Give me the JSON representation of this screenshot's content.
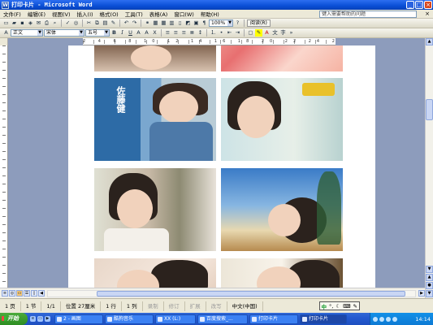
{
  "window": {
    "title": "打印卡片 - Microsoft Word",
    "icon_letter": "W"
  },
  "menu": {
    "items": [
      "文件(F)",
      "编辑(E)",
      "视图(V)",
      "插入(I)",
      "格式(O)",
      "工具(T)",
      "表格(A)",
      "窗口(W)",
      "帮助(H)"
    ],
    "help_placeholder": "键入需要帮助的问题"
  },
  "toolbar1": {
    "zoom": "100%",
    "read_label": "阅读(R)"
  },
  "toolbar2": {
    "style": "正文",
    "font": "宋体",
    "size": "五号"
  },
  "ruler": {
    "numbers": "2 4 6 8 10 12 14 16 18 20 22 24 26"
  },
  "photos": [
    {
      "caption": ""
    },
    {
      "caption": ""
    },
    {
      "caption": "佐藤健"
    },
    {
      "caption": ""
    },
    {
      "caption": ""
    },
    {
      "caption": ""
    },
    {
      "caption": ""
    },
    {
      "caption": ""
    }
  ],
  "status": {
    "page": "1 页",
    "section": "1 节",
    "pages": "1/1",
    "position": "位置 27厘米",
    "line": "1 行",
    "column": "1 列",
    "rec": "录制",
    "trk": "修订",
    "ext": "扩展",
    "ovr": "改写",
    "lang": "中文(中国)"
  },
  "ime": {
    "label": "中"
  },
  "taskbar": {
    "start": "开始",
    "tasks": [
      {
        "label": "2 - 画图"
      },
      {
        "label": "酷狗音乐"
      },
      {
        "label": "XX (L:)"
      },
      {
        "label": "百度搜索_..."
      },
      {
        "label": "打印卡片"
      },
      {
        "label": "打印卡片"
      }
    ],
    "clock": "14:14"
  },
  "colors": {
    "titlebar": "#0a4fd6",
    "taskbar": "#245ad0",
    "start": "#2d8d22"
  }
}
